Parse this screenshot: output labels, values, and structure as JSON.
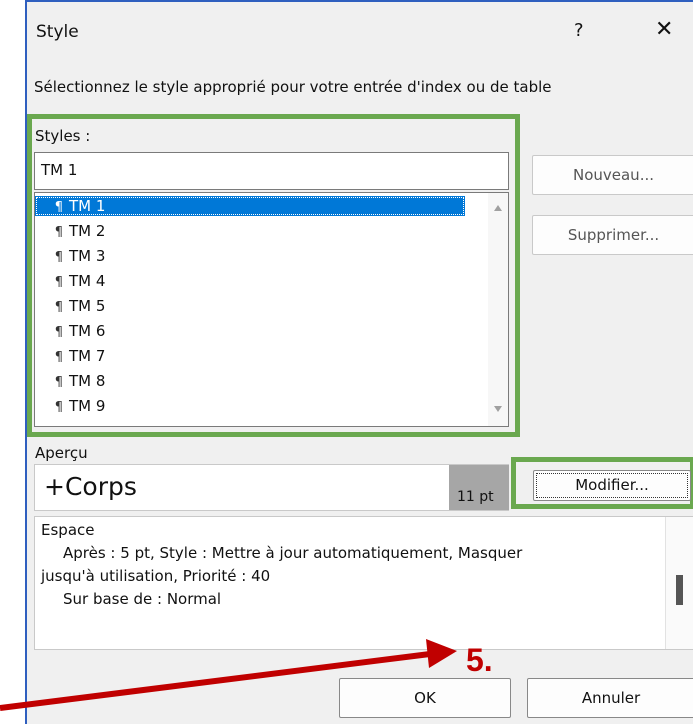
{
  "dialog": {
    "title": "Style",
    "help_label": "?",
    "close_label": "✕",
    "instruction": "Sélectionnez le style approprié pour votre entrée d'index ou de table"
  },
  "styles": {
    "label": "Styles :",
    "input_value": "TM 1",
    "items": [
      {
        "glyph": "¶",
        "label": "TM 1"
      },
      {
        "glyph": "¶",
        "label": "TM 2"
      },
      {
        "glyph": "¶",
        "label": "TM 3"
      },
      {
        "glyph": "¶",
        "label": "TM 4"
      },
      {
        "glyph": "¶",
        "label": "TM 5"
      },
      {
        "glyph": "¶",
        "label": "TM 6"
      },
      {
        "glyph": "¶",
        "label": "TM 7"
      },
      {
        "glyph": "¶",
        "label": "TM 8"
      },
      {
        "glyph": "¶",
        "label": "TM 9"
      }
    ],
    "selected_index": 0,
    "scroll_up_icon": "triangle-up",
    "scroll_down_icon": "triangle-down"
  },
  "buttons": {
    "new_label": "Nouveau...",
    "delete_label": "Supprimer...",
    "modify_label": "Modifier...",
    "ok_label": "OK",
    "cancel_label": "Annuler"
  },
  "preview": {
    "label": "Aperçu",
    "font_text": "+Corps",
    "size_text": "11 pt"
  },
  "description": {
    "line1": "Espace",
    "line2": "Après : 5 pt, Style : Mettre à jour automatiquement, Masquer",
    "line3": "jusqu'à utilisation, Priorité : 40",
    "line4": "Sur base de : Normal"
  },
  "annotation": {
    "step_label": "5.",
    "color": "#c00000",
    "highlight_color": "#6aa84f"
  }
}
